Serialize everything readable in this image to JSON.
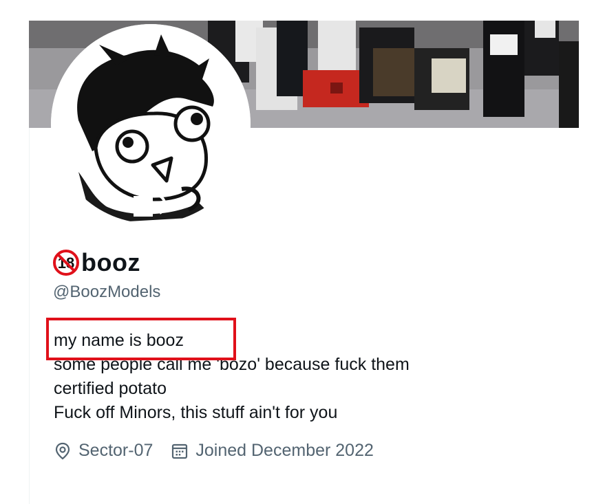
{
  "profile": {
    "display_name": "booz",
    "handle": "@BoozModels",
    "name_badge": "18-prohibited-icon",
    "bio_lines": [
      "my name is booz",
      "some people call me 'bozo' because fuck them",
      "certified potato",
      "Fuck off Minors, this stuff ain't for you"
    ],
    "location": "Sector-07",
    "joined": "Joined December 2022",
    "location_icon": "location-pin-icon",
    "joined_icon": "calendar-icon"
  },
  "colors": {
    "text_primary": "#0f1419",
    "text_secondary": "#536471",
    "highlight": "#e0101a",
    "badge_red": "#e0101a"
  }
}
